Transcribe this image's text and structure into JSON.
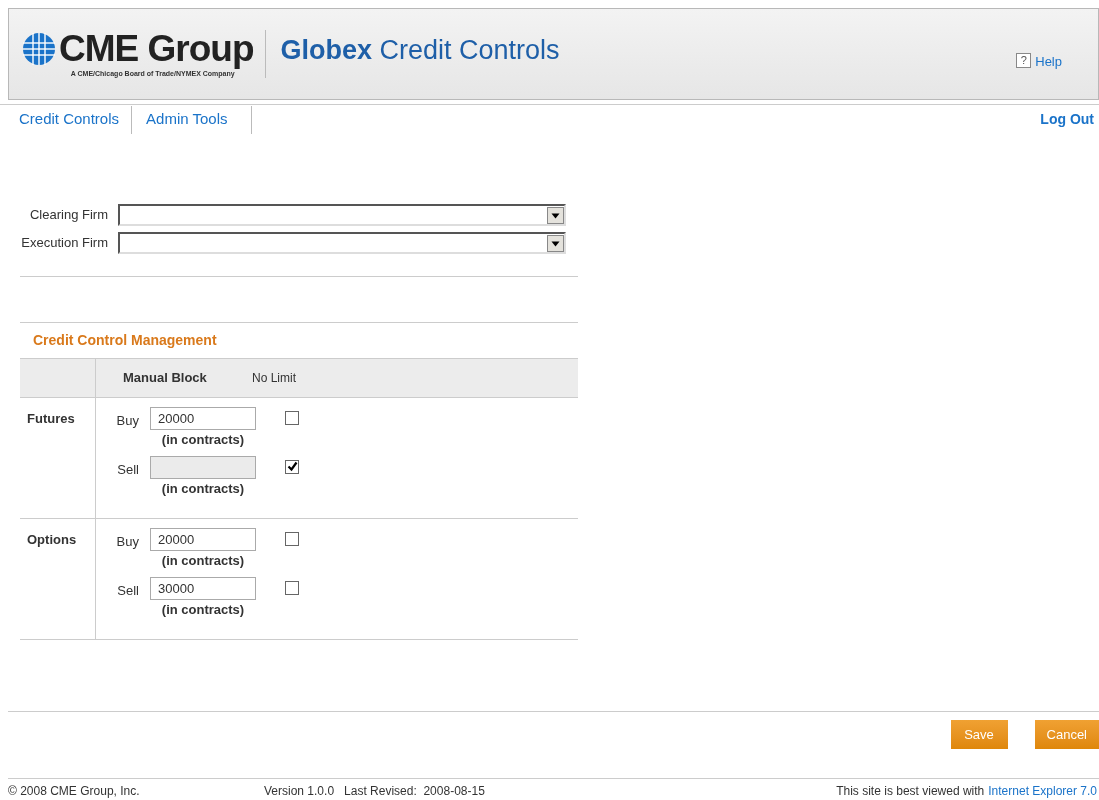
{
  "header": {
    "logo": {
      "name": "CME Group",
      "tagline": "A CME/Chicago Board of Trade/NYMEX Company"
    },
    "app_title": "**Globex** Credit Controls",
    "help_icon": "?",
    "help_link": "Help"
  },
  "nav": {
    "tabs": [
      {
        "label": "Credit Controls"
      },
      {
        "label": "Admin Tools"
      }
    ],
    "logout": "Log Out"
  },
  "filters": [
    {
      "label": "Clearing Firm"
    },
    {
      "label": "Execution Firm"
    }
  ],
  "section_title": "Credit Control Management",
  "table": {
    "columns": [
      "Manual Block",
      "No Limit"
    ],
    "groups": [
      {
        "name": "Futures",
        "rows": [
          {
            "side": "Buy",
            "value": "20000",
            "unit": "(in contracts)",
            "disabled": false,
            "no_limit": false
          },
          {
            "side": "Sell",
            "unit": "(in contracts)",
            "disabled": true,
            "no_limit": true
          }
        ]
      },
      {
        "name": "Options",
        "rows": [
          {
            "side": "Buy",
            "value": "20000",
            "unit": "(in contracts)",
            "disabled": false,
            "no_limit": false
          },
          {
            "side": "Sell",
            "value": "30000",
            "unit": "(in contracts)",
            "disabled": false,
            "no_limit": false
          }
        ]
      }
    ]
  },
  "buttons": [
    "Save",
    "Cancel"
  ],
  "footer": {
    "copyright": "© 2008 CME Group, Inc.",
    "version": "Version 1.0.0",
    "revised": "Last Revised:  2008-08-15",
    "note": "This site is best viewed with",
    "link": "Internet Explorer 7.0"
  }
}
